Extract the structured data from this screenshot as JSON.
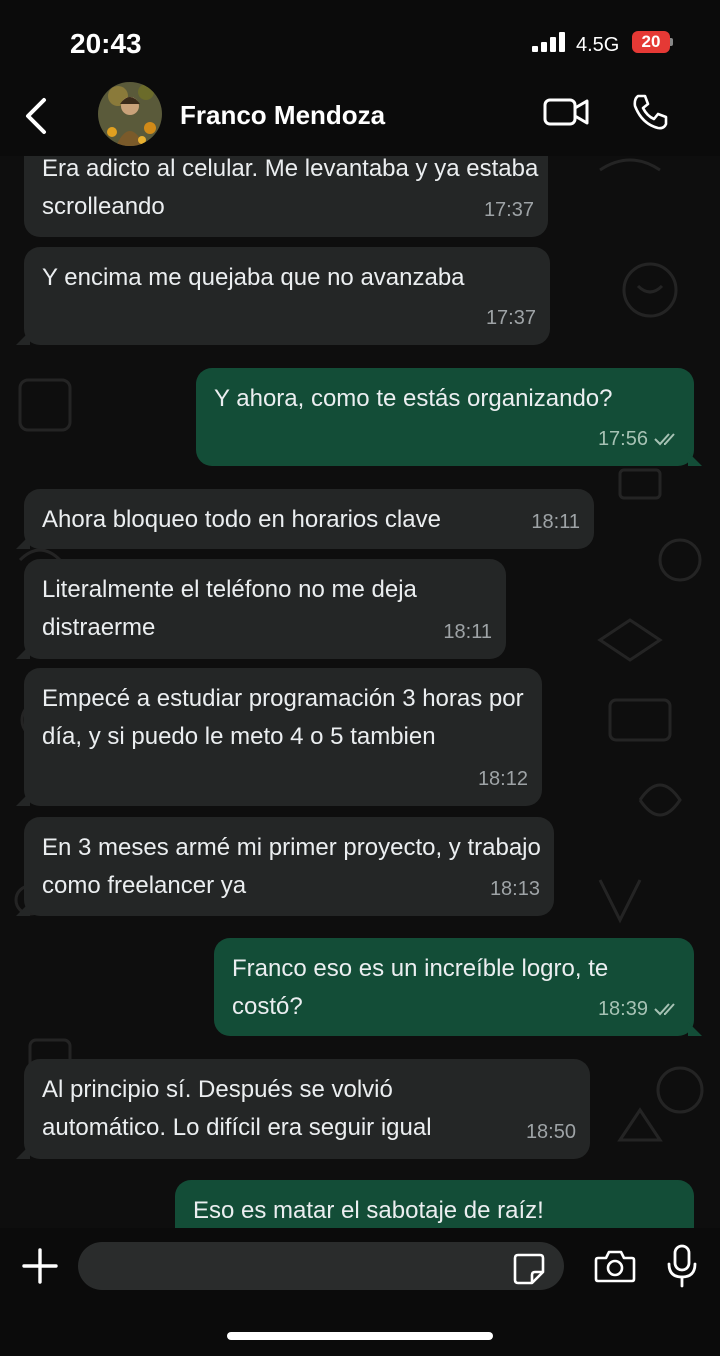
{
  "status_bar": {
    "time": "20:43",
    "network": "4.5G",
    "battery": "20",
    "battery_color": "#e53935"
  },
  "header": {
    "contact_name": "Franco Mendoza",
    "icons": [
      "back-icon",
      "avatar",
      "video-call-icon",
      "phone-call-icon"
    ]
  },
  "messages": [
    {
      "direction": "in",
      "text": "Era adicto al celular. Me levantaba y ya estaba scrolleando",
      "time": "17:37"
    },
    {
      "direction": "in",
      "text": "Y encima me quejaba que no avanzaba",
      "time": "17:37"
    },
    {
      "direction": "out",
      "text": "Y ahora, como te estás organizando?",
      "time": "17:56",
      "read": true
    },
    {
      "direction": "in",
      "text": "Ahora bloqueo todo en horarios clave",
      "time": "18:11"
    },
    {
      "direction": "in",
      "text": "Literalmente el teléfono no me deja distraerme",
      "time": "18:11"
    },
    {
      "direction": "in",
      "text": "Empecé a estudiar programación 3 horas por día, y si puedo le meto 4 o 5 tambien",
      "time": "18:12"
    },
    {
      "direction": "in",
      "text": "En 3 meses armé mi primer proyecto, y trabajo como freelancer ya",
      "time": "18:13"
    },
    {
      "direction": "out",
      "text": "Franco eso es un increíble logro, te costó?",
      "time": "18:39",
      "read": true
    },
    {
      "direction": "in",
      "text": "Al principio sí. Después se volvió automático. Lo difícil era seguir igual",
      "time": "18:50"
    },
    {
      "direction": "out",
      "text": "Eso es matar el sabotaje de raíz!",
      "time": ""
    }
  ],
  "composer": {
    "icons": [
      "plus-icon",
      "sticker-icon",
      "camera-icon",
      "microphone-icon"
    ]
  },
  "colors": {
    "incoming_bubble": "#242626",
    "outgoing_bubble": "#134d37",
    "background": "#0e0e0e"
  }
}
